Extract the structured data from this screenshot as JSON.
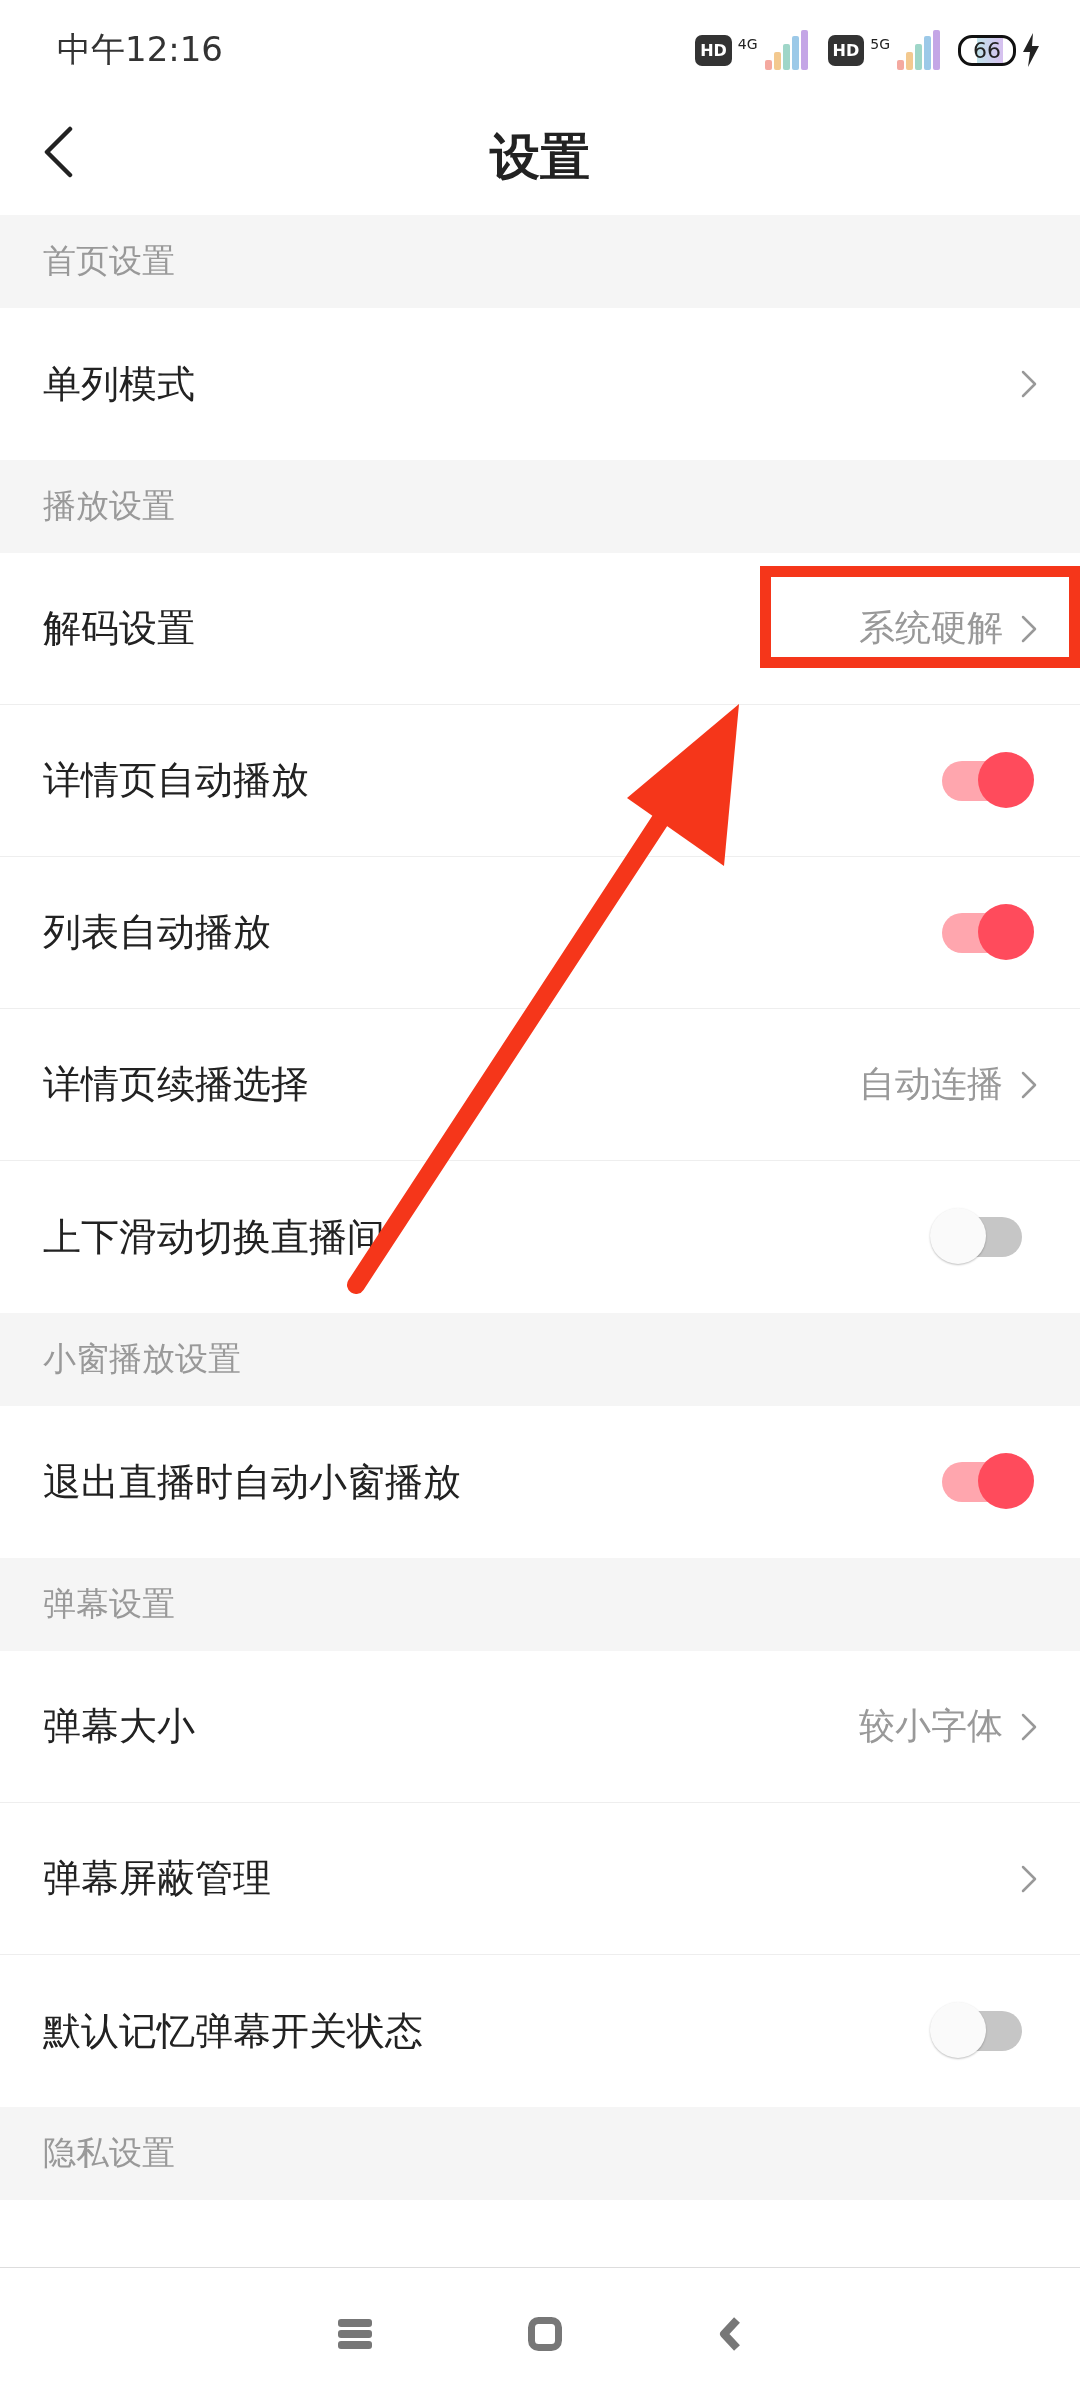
{
  "status_bar": {
    "time": "中午12:16",
    "hd_badges": [
      "HD",
      "HD"
    ],
    "networks": [
      "4G",
      "5G"
    ],
    "battery": "66"
  },
  "header": {
    "title": "设置"
  },
  "sections": [
    {
      "title": "首页设置",
      "rows": [
        {
          "kind": "nav",
          "label": "单列模式"
        }
      ]
    },
    {
      "title": "播放设置",
      "rows": [
        {
          "kind": "nav",
          "label": "解码设置",
          "value": "系统硬解"
        },
        {
          "kind": "toggle",
          "label": "详情页自动播放",
          "on": true
        },
        {
          "kind": "toggle",
          "label": "列表自动播放",
          "on": true
        },
        {
          "kind": "nav",
          "label": "详情页续播选择",
          "value": "自动连播"
        },
        {
          "kind": "toggle",
          "label": "上下滑动切换直播间",
          "on": false
        }
      ]
    },
    {
      "title": "小窗播放设置",
      "rows": [
        {
          "kind": "toggle",
          "label": "退出直播时自动小窗播放",
          "on": true
        }
      ]
    },
    {
      "title": "弹幕设置",
      "rows": [
        {
          "kind": "nav",
          "label": "弹幕大小",
          "value": "较小字体"
        },
        {
          "kind": "nav",
          "label": "弹幕屏蔽管理"
        },
        {
          "kind": "toggle",
          "label": "默认记忆弹幕开关状态",
          "on": false
        }
      ]
    },
    {
      "title": "隐私设置",
      "rows": [
        {
          "kind": "cut"
        }
      ]
    }
  ]
}
